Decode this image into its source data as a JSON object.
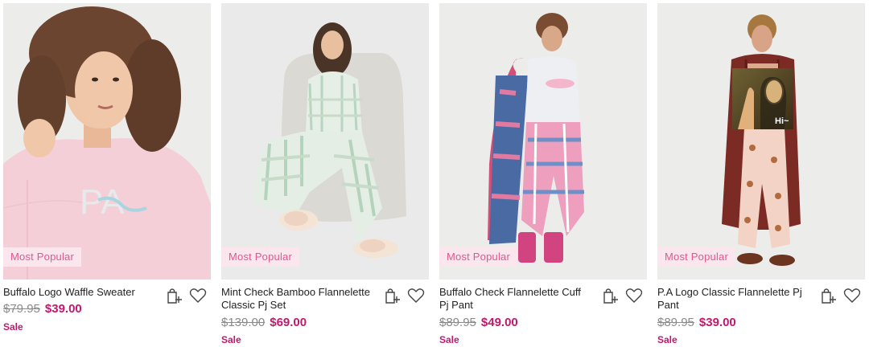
{
  "products": [
    {
      "title": "Buffalo Logo Waffle Sweater",
      "badge": "Most Popular",
      "was_price": "$79.95",
      "price": "$39.00",
      "sale": "Sale",
      "image_icon": "model-pink-waffle-sweater"
    },
    {
      "title": "Mint Check Bamboo Flannelette Classic Pj Set",
      "badge": "Most Popular",
      "was_price": "$139.00",
      "price": "$69.00",
      "sale": "Sale",
      "image_icon": "model-mint-check-pj-set"
    },
    {
      "title": "Buffalo Check Flannelette Cuff Pj Pant",
      "badge": "Most Popular",
      "was_price": "$89.95",
      "price": "$49.00",
      "sale": "Sale",
      "image_icon": "model-check-pj-pant"
    },
    {
      "title": "P.A Logo Classic Flannelette Pj Pant",
      "badge": "Most Popular",
      "was_price": "$89.95",
      "price": "$39.00",
      "sale": "Sale",
      "overlay_text": "Hi~",
      "image_icon": "model-logo-pj-pant"
    }
  ],
  "colors": {
    "badge_bg": "#fbe6ee",
    "badge_text": "#e0588e",
    "sale_price": "#c0186e",
    "was_price": "#8a8a8a"
  },
  "icons": [
    "add-to-bag-icon",
    "wishlist-heart-icon"
  ]
}
